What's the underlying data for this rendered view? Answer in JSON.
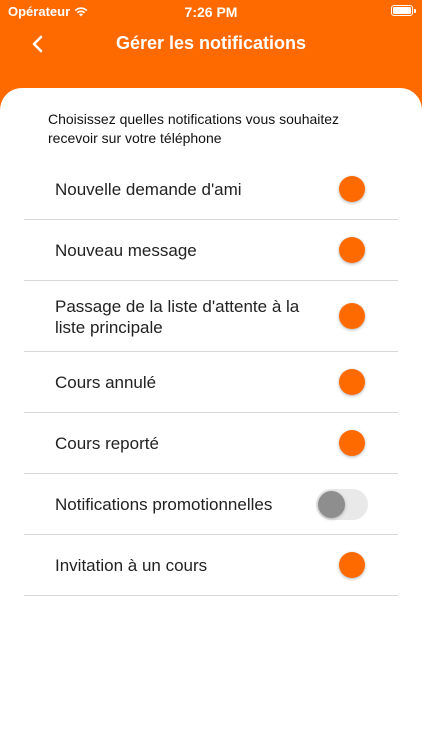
{
  "status_bar": {
    "carrier": "Opérateur",
    "time": "7:26 PM"
  },
  "header": {
    "title": "Gérer les notifications",
    "back_icon": "chevron-left-icon",
    "color": "#ff6a00"
  },
  "intro_text": "Choisissez quelles notifications vous souhaitez recevoir sur votre téléphone",
  "settings": [
    {
      "label": "Nouvelle demande d'ami",
      "enabled": true
    },
    {
      "label": "Nouveau message",
      "enabled": true
    },
    {
      "label": "Passage de la liste d'attente à la liste principale",
      "enabled": true
    },
    {
      "label": "Cours annulé",
      "enabled": true
    },
    {
      "label": "Cours reporté",
      "enabled": true
    },
    {
      "label": "Notifications promotionnelles",
      "enabled": false
    },
    {
      "label": "Invitation à un cours",
      "enabled": true
    }
  ]
}
